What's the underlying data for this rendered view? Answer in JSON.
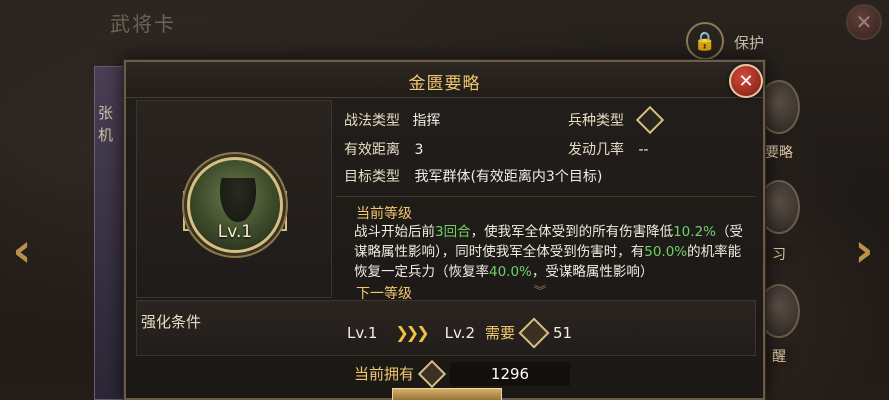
{
  "background": {
    "title": "武将卡",
    "lock_label": "保护",
    "left_card_text": "张机",
    "side_skills": [
      {
        "label": "要略"
      },
      {
        "label": "习"
      },
      {
        "label": "醒"
      }
    ]
  },
  "dialog": {
    "title": "金匮要略",
    "skill_level": "Lv.1",
    "info": {
      "tactic_type_label": "战法类型",
      "tactic_type_value": "指挥",
      "troop_type_label": "兵种类型",
      "range_label": "有效距离",
      "range_value": "3",
      "trigger_label": "发动几率",
      "trigger_value": "--",
      "target_label": "目标类型",
      "target_value": "我军群体(有效距离内3个目标)"
    },
    "current_level": {
      "title": "当前等级",
      "desc_part1": "战斗开始后前",
      "turns": "3回合",
      "desc_part2": "，使我军全体受到的所有伤害降低",
      "reduce_pct": "10.2%",
      "desc_part3": "（受谋略属性影响），同时使我军全体受到伤害时，有",
      "chance_pct": "50.0%",
      "desc_part4": "的机率能恢复一定兵力（恢复率",
      "recover_pct": "40.0%",
      "desc_part5": "，受谋略属性影响）"
    },
    "next_level_title": "下一等级",
    "upgrade": {
      "label": "强化条件",
      "from_level": "Lv.1",
      "arrows": "❯❯❯",
      "to_level": "Lv.2",
      "need_label": "需要",
      "need_count": "51"
    },
    "own": {
      "label": "当前拥有",
      "count": "1296"
    }
  }
}
